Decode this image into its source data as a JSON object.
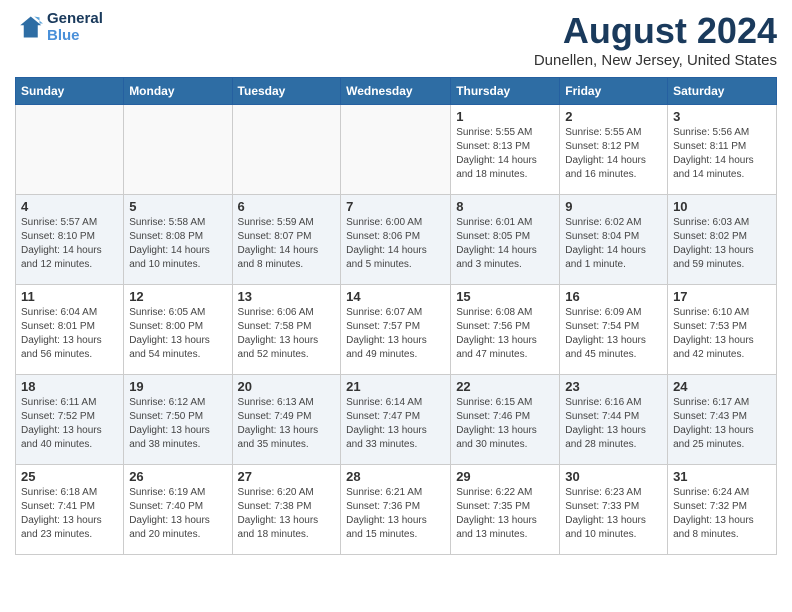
{
  "header": {
    "logo_line1": "General",
    "logo_line2": "Blue",
    "month": "August 2024",
    "location": "Dunellen, New Jersey, United States"
  },
  "weekdays": [
    "Sunday",
    "Monday",
    "Tuesday",
    "Wednesday",
    "Thursday",
    "Friday",
    "Saturday"
  ],
  "weeks": [
    [
      {
        "day": "",
        "info": ""
      },
      {
        "day": "",
        "info": ""
      },
      {
        "day": "",
        "info": ""
      },
      {
        "day": "",
        "info": ""
      },
      {
        "day": "1",
        "info": "Sunrise: 5:55 AM\nSunset: 8:13 PM\nDaylight: 14 hours\nand 18 minutes."
      },
      {
        "day": "2",
        "info": "Sunrise: 5:55 AM\nSunset: 8:12 PM\nDaylight: 14 hours\nand 16 minutes."
      },
      {
        "day": "3",
        "info": "Sunrise: 5:56 AM\nSunset: 8:11 PM\nDaylight: 14 hours\nand 14 minutes."
      }
    ],
    [
      {
        "day": "4",
        "info": "Sunrise: 5:57 AM\nSunset: 8:10 PM\nDaylight: 14 hours\nand 12 minutes."
      },
      {
        "day": "5",
        "info": "Sunrise: 5:58 AM\nSunset: 8:08 PM\nDaylight: 14 hours\nand 10 minutes."
      },
      {
        "day": "6",
        "info": "Sunrise: 5:59 AM\nSunset: 8:07 PM\nDaylight: 14 hours\nand 8 minutes."
      },
      {
        "day": "7",
        "info": "Sunrise: 6:00 AM\nSunset: 8:06 PM\nDaylight: 14 hours\nand 5 minutes."
      },
      {
        "day": "8",
        "info": "Sunrise: 6:01 AM\nSunset: 8:05 PM\nDaylight: 14 hours\nand 3 minutes."
      },
      {
        "day": "9",
        "info": "Sunrise: 6:02 AM\nSunset: 8:04 PM\nDaylight: 14 hours\nand 1 minute."
      },
      {
        "day": "10",
        "info": "Sunrise: 6:03 AM\nSunset: 8:02 PM\nDaylight: 13 hours\nand 59 minutes."
      }
    ],
    [
      {
        "day": "11",
        "info": "Sunrise: 6:04 AM\nSunset: 8:01 PM\nDaylight: 13 hours\nand 56 minutes."
      },
      {
        "day": "12",
        "info": "Sunrise: 6:05 AM\nSunset: 8:00 PM\nDaylight: 13 hours\nand 54 minutes."
      },
      {
        "day": "13",
        "info": "Sunrise: 6:06 AM\nSunset: 7:58 PM\nDaylight: 13 hours\nand 52 minutes."
      },
      {
        "day": "14",
        "info": "Sunrise: 6:07 AM\nSunset: 7:57 PM\nDaylight: 13 hours\nand 49 minutes."
      },
      {
        "day": "15",
        "info": "Sunrise: 6:08 AM\nSunset: 7:56 PM\nDaylight: 13 hours\nand 47 minutes."
      },
      {
        "day": "16",
        "info": "Sunrise: 6:09 AM\nSunset: 7:54 PM\nDaylight: 13 hours\nand 45 minutes."
      },
      {
        "day": "17",
        "info": "Sunrise: 6:10 AM\nSunset: 7:53 PM\nDaylight: 13 hours\nand 42 minutes."
      }
    ],
    [
      {
        "day": "18",
        "info": "Sunrise: 6:11 AM\nSunset: 7:52 PM\nDaylight: 13 hours\nand 40 minutes."
      },
      {
        "day": "19",
        "info": "Sunrise: 6:12 AM\nSunset: 7:50 PM\nDaylight: 13 hours\nand 38 minutes."
      },
      {
        "day": "20",
        "info": "Sunrise: 6:13 AM\nSunset: 7:49 PM\nDaylight: 13 hours\nand 35 minutes."
      },
      {
        "day": "21",
        "info": "Sunrise: 6:14 AM\nSunset: 7:47 PM\nDaylight: 13 hours\nand 33 minutes."
      },
      {
        "day": "22",
        "info": "Sunrise: 6:15 AM\nSunset: 7:46 PM\nDaylight: 13 hours\nand 30 minutes."
      },
      {
        "day": "23",
        "info": "Sunrise: 6:16 AM\nSunset: 7:44 PM\nDaylight: 13 hours\nand 28 minutes."
      },
      {
        "day": "24",
        "info": "Sunrise: 6:17 AM\nSunset: 7:43 PM\nDaylight: 13 hours\nand 25 minutes."
      }
    ],
    [
      {
        "day": "25",
        "info": "Sunrise: 6:18 AM\nSunset: 7:41 PM\nDaylight: 13 hours\nand 23 minutes."
      },
      {
        "day": "26",
        "info": "Sunrise: 6:19 AM\nSunset: 7:40 PM\nDaylight: 13 hours\nand 20 minutes."
      },
      {
        "day": "27",
        "info": "Sunrise: 6:20 AM\nSunset: 7:38 PM\nDaylight: 13 hours\nand 18 minutes."
      },
      {
        "day": "28",
        "info": "Sunrise: 6:21 AM\nSunset: 7:36 PM\nDaylight: 13 hours\nand 15 minutes."
      },
      {
        "day": "29",
        "info": "Sunrise: 6:22 AM\nSunset: 7:35 PM\nDaylight: 13 hours\nand 13 minutes."
      },
      {
        "day": "30",
        "info": "Sunrise: 6:23 AM\nSunset: 7:33 PM\nDaylight: 13 hours\nand 10 minutes."
      },
      {
        "day": "31",
        "info": "Sunrise: 6:24 AM\nSunset: 7:32 PM\nDaylight: 13 hours\nand 8 minutes."
      }
    ]
  ]
}
